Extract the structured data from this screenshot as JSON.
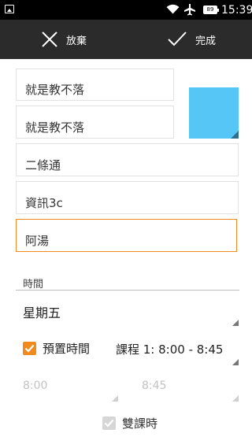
{
  "status_bar": {
    "time": "15:39",
    "battery_level": "89",
    "icons": [
      "photo-icon",
      "wifi-icon",
      "airplane-mode-icon",
      "battery-icon"
    ]
  },
  "action_bar": {
    "discard_label": "放棄",
    "done_label": "完成",
    "icons": [
      "close-icon",
      "checkmark-icon"
    ]
  },
  "fields": {
    "course_name": "就是教不落",
    "course_name_2": "就是教不落",
    "classroom": "二條通",
    "teacher": "資訊3c",
    "note": "阿湯"
  },
  "color": {
    "selected": "#56c6f6",
    "accent": "#ef8a24"
  },
  "time_section": {
    "title": "時間",
    "weekday": "星期五",
    "preset_time_label": "預置時間",
    "preset_time_checked": true,
    "period": "課程 1: 8:00 - 8:45",
    "start_time": "8:00",
    "end_time": "8:45",
    "double_period_label": "雙課時",
    "double_period_checked": true
  }
}
